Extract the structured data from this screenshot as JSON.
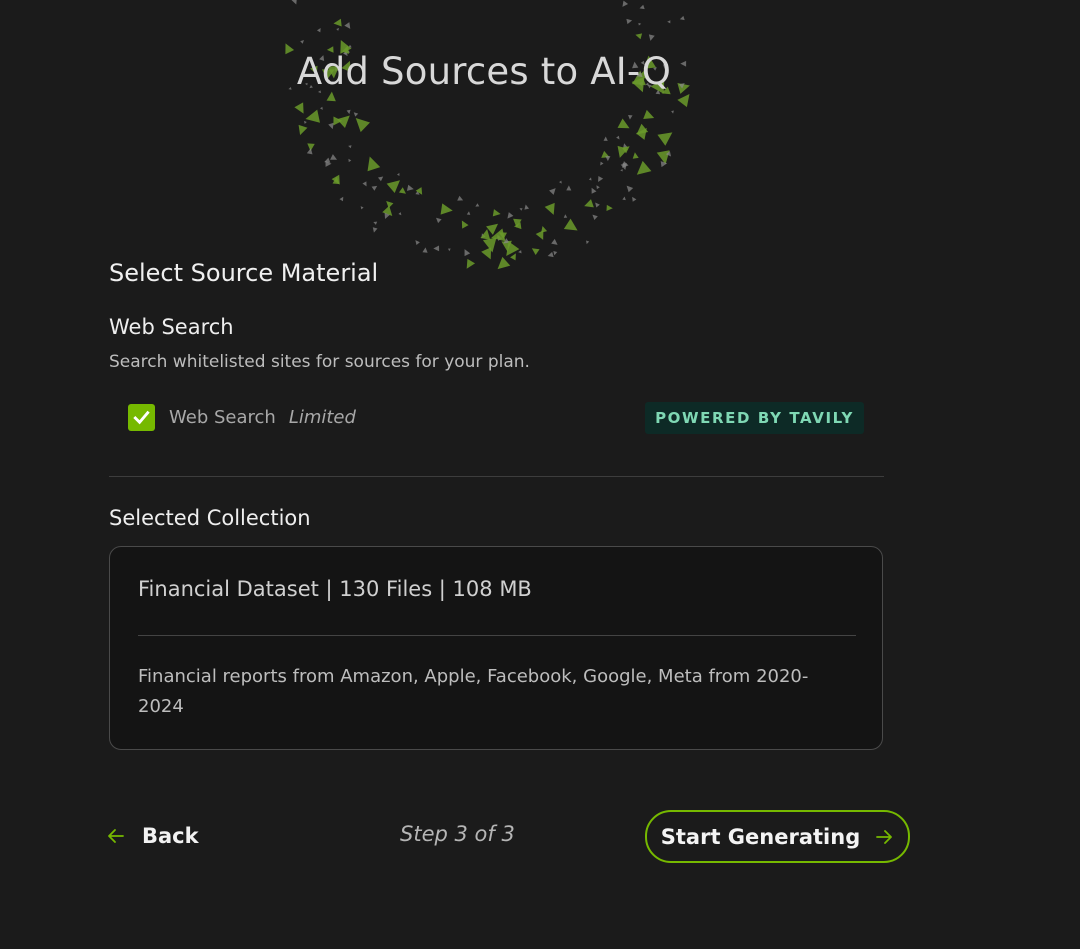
{
  "header": {
    "title": "Add Sources to AI-Q"
  },
  "source_material": {
    "heading": "Select Source Material",
    "web_search": {
      "title": "Web Search",
      "description": "Search whitelisted sites for sources for your plan.",
      "checkbox_label": "Web Search",
      "checkbox_tag": "Limited",
      "checked": true,
      "badge": "POWERED BY TAVILY"
    }
  },
  "collection": {
    "heading": "Selected Collection",
    "summary": "Financial Dataset | 130 Files | 108 MB",
    "description": "Financial reports from Amazon, Apple, Facebook, Google, Meta from 2020-2024"
  },
  "footer": {
    "back_label": "Back",
    "step_text": "Step 3 of 3",
    "start_label": "Start Generating"
  },
  "colors": {
    "accent": "#76b900",
    "background": "#1b1b1b",
    "badge_bg": "#0d2a26",
    "badge_text": "#7fd8b4"
  },
  "icons": {
    "back": "arrow-left-icon",
    "forward": "arrow-right-icon",
    "check": "checkmark-icon"
  }
}
